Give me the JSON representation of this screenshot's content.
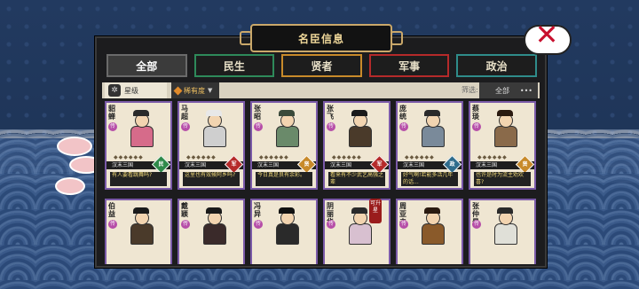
{
  "window": {
    "title": "名臣信息"
  },
  "tabs": [
    {
      "label": "全部",
      "active": true
    },
    {
      "label": "民生"
    },
    {
      "label": "贤者"
    },
    {
      "label": "军事"
    },
    {
      "label": "政治"
    }
  ],
  "toolbar": {
    "rank_label": "星级",
    "sort_label": "稀有度",
    "filter_label": "筛选:",
    "filter_value": "全部",
    "more": "•••"
  },
  "cards_row1": [
    {
      "name": "貂蝉",
      "rarity": "传",
      "stars": "◆◆◆◆◆◆",
      "era": "汉末三国",
      "role": "民",
      "role_color": "#2f8a4a",
      "quote": "有人要看跳舞吗?"
    },
    {
      "name": "马超",
      "rarity": "传",
      "stars": "◆◆◆◆◆◆",
      "era": "汉末三国",
      "role": "军",
      "role_color": "#b52a2a",
      "quote": "这里也有效候阿乡吗?"
    },
    {
      "name": "张昭",
      "rarity": "传",
      "stars": "◆◆◆◆◆◆",
      "era": "汉末三国",
      "role": "贤",
      "role_color": "#c88a2a",
      "quote": "今日真是良有余彩。"
    },
    {
      "name": "张飞",
      "rarity": "传",
      "stars": "◆◆◆◆◆◆",
      "era": "汉末三国",
      "role": "军",
      "role_color": "#b52a2a",
      "quote": "看来有不少武艺高强之辈"
    },
    {
      "name": "庞统",
      "rarity": "传",
      "stars": "◆◆◆◆◆◆",
      "era": "汉末三国",
      "role": "政",
      "role_color": "#2f6c8c",
      "quote": "好气啊!若能多活几年的话..."
    },
    {
      "name": "蔡琰",
      "rarity": "传",
      "stars": "◆◆◆◆◆◆",
      "era": "汉末三国",
      "role": "贤",
      "role_color": "#c88a2a",
      "quote": "也许是时为流主劝欢喜?"
    }
  ],
  "cards_row2": [
    {
      "name": "伯益",
      "rarity": "传"
    },
    {
      "name": "戴颖",
      "rarity": "传"
    },
    {
      "name": "冯异",
      "rarity": "传"
    },
    {
      "name": "阴丽华",
      "rarity": "传"
    },
    {
      "name": "周亚夫",
      "rarity": "传"
    },
    {
      "name": "张仲景",
      "rarity": "传"
    }
  ],
  "badge": {
    "label": "可升星"
  }
}
